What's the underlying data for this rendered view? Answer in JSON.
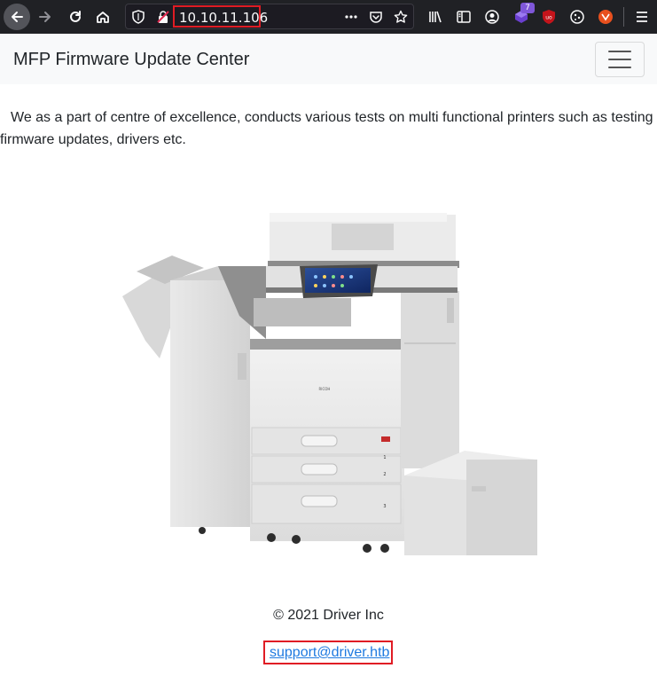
{
  "browser": {
    "url": "10.10.11.106",
    "extension_badge": "7"
  },
  "navbar": {
    "brand": "MFP Firmware Update Center"
  },
  "main": {
    "intro_line1": "We as a part of centre of excellence, conducts various tests on multi functional printers such as testing",
    "intro_line2": "firmware updates, drivers etc.",
    "printer_label": "RICOH"
  },
  "footer": {
    "copyright": "© 2021 Driver Inc",
    "support_email": "support@driver.htb"
  },
  "colors": {
    "toolbar_bg": "#202125",
    "navbar_bg": "#f8f9fa",
    "highlight_red": "#e01c24",
    "link_blue": "#1f7ae0"
  }
}
